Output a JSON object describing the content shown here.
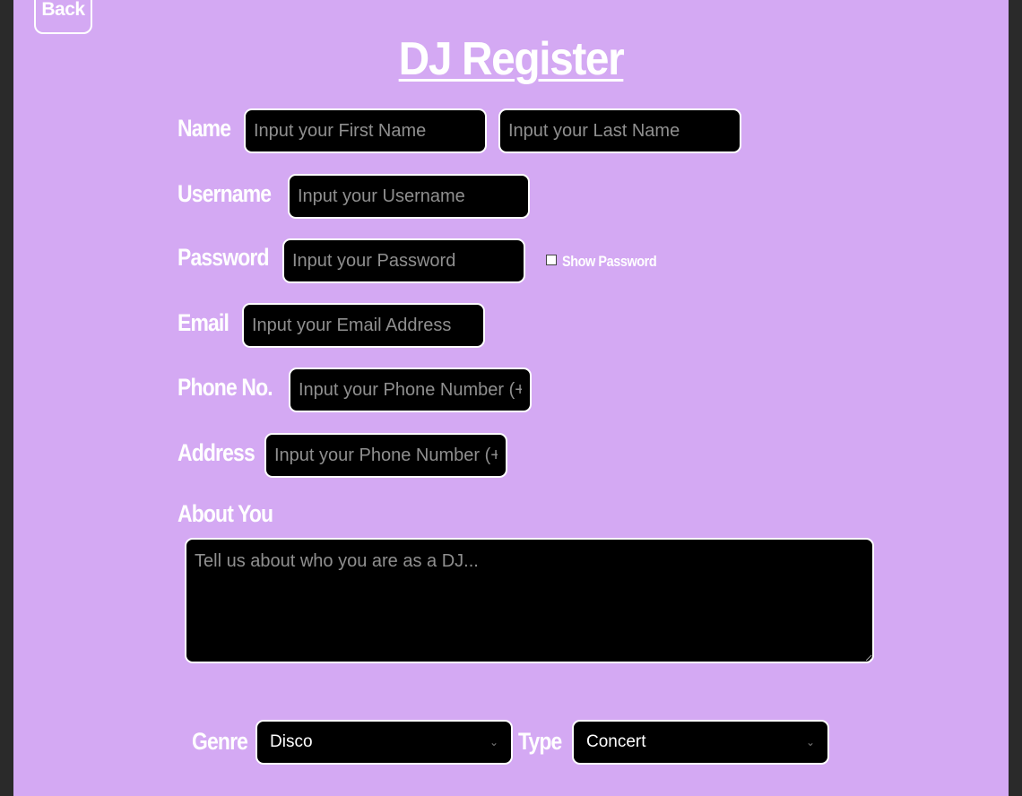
{
  "back_label": "Back",
  "title": "DJ Register",
  "form": {
    "name_label": "Name",
    "first_name_placeholder": "Input your First Name",
    "last_name_placeholder": "Input your Last Name",
    "username_label": "Username",
    "username_placeholder": "Input your Username",
    "password_label": "Password",
    "password_placeholder": "Input your Password",
    "show_password_label": "Show Password",
    "email_label": "Email",
    "email_placeholder": "Input your Email Address",
    "phone_label": "Phone No.",
    "phone_placeholder": "Input your Phone Number (+",
    "address_label": "Address",
    "address_placeholder": "Input your Phone Number (+",
    "about_label": "About You",
    "about_placeholder": "Tell us about who you are as a DJ...",
    "genre_label": "Genre",
    "genre_value": "Disco",
    "type_label": "Type",
    "type_value": "Concert"
  },
  "colors": {
    "background": "#d4a9f3",
    "field": "#000000",
    "border": "#ffffff"
  }
}
